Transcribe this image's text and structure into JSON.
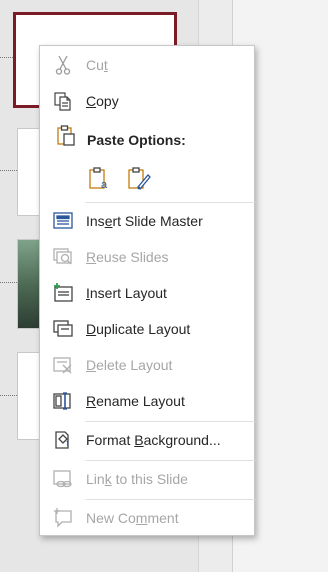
{
  "menu": {
    "cut": {
      "pre": "Cu",
      "key": "t",
      "post": "",
      "disabled": true
    },
    "copy": {
      "pre": "",
      "key": "C",
      "post": "opy",
      "disabled": false
    },
    "paste_options": "Paste Options:",
    "insert_slide_master": {
      "pre": "Ins",
      "key": "e",
      "post": "rt Slide Master",
      "disabled": false
    },
    "reuse_slides": {
      "pre": "",
      "key": "R",
      "post": "euse Slides",
      "disabled": true
    },
    "insert_layout": {
      "pre": "",
      "key": "I",
      "post": "nsert Layout",
      "disabled": false
    },
    "duplicate_layout": {
      "pre": "",
      "key": "D",
      "post": "uplicate Layout",
      "disabled": false
    },
    "delete_layout": {
      "pre": "",
      "key": "D",
      "post": "elete Layout",
      "disabled": true
    },
    "rename_layout": {
      "pre": "",
      "key": "R",
      "post": "ename Layout",
      "disabled": false
    },
    "format_background": {
      "pre": "Format ",
      "key": "B",
      "post": "ackground...",
      "disabled": false
    },
    "link_to_slide": {
      "pre": "Lin",
      "key": "k",
      "post": " to this Slide",
      "disabled": true
    },
    "new_comment": {
      "pre": "New Co",
      "key": "m",
      "post": "ment",
      "disabled": true
    }
  },
  "colors": {
    "disabled_text": "#a6a6a6",
    "text": "#262626",
    "accent_blue": "#2b579a",
    "paste_orange": "#c27c0e",
    "selection_border": "#7b1b26"
  }
}
